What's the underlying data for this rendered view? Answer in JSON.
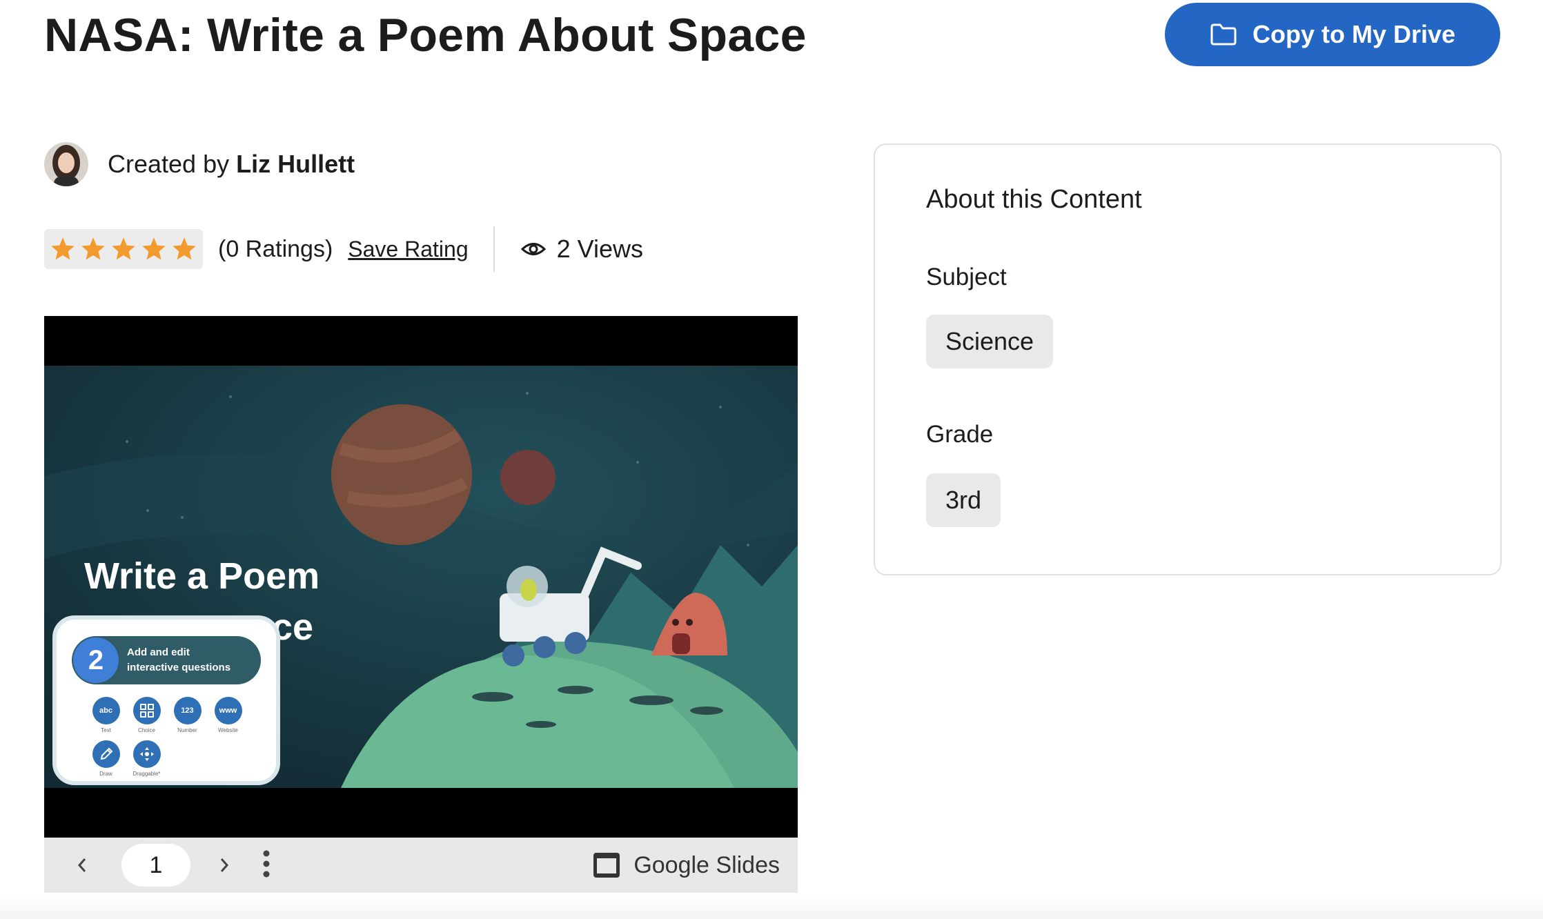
{
  "page": {
    "title": "NASA: Write a Poem About Space",
    "copy_button_label": "Copy to My Drive"
  },
  "creator": {
    "prefix": "Created by",
    "name": "Liz Hullett"
  },
  "rating": {
    "stars": 5,
    "count_text": "(0 Ratings)",
    "save_label": "Save Rating",
    "views_text": "2 Views"
  },
  "slide": {
    "title_line1": "Write a Poem",
    "title_line2_visible": "ce",
    "popup": {
      "step": "2",
      "heading_line1": "Add and edit",
      "heading_line2": "interactive questions",
      "tools": [
        {
          "label": "Text",
          "glyph": "abc",
          "icon": "text-icon"
        },
        {
          "label": "Choice",
          "glyph": "",
          "icon": "grid-icon"
        },
        {
          "label": "Number",
          "glyph": "123",
          "icon": "number-icon"
        },
        {
          "label": "Website",
          "glyph": "www",
          "icon": "website-icon"
        },
        {
          "label": "Draw",
          "glyph": "",
          "icon": "pencil-icon"
        },
        {
          "label": "Draggable*",
          "glyph": "",
          "icon": "move-icon"
        }
      ]
    }
  },
  "viewer": {
    "current_page": "1",
    "provider_label": "Google Slides"
  },
  "about": {
    "title": "About this Content",
    "subject_label": "Subject",
    "subject_value": "Science",
    "grade_label": "Grade",
    "grade_value": "3rd"
  },
  "colors": {
    "accent": "#2466c4",
    "star": "#f39a2e",
    "slide_bg": "#1a3a46"
  }
}
